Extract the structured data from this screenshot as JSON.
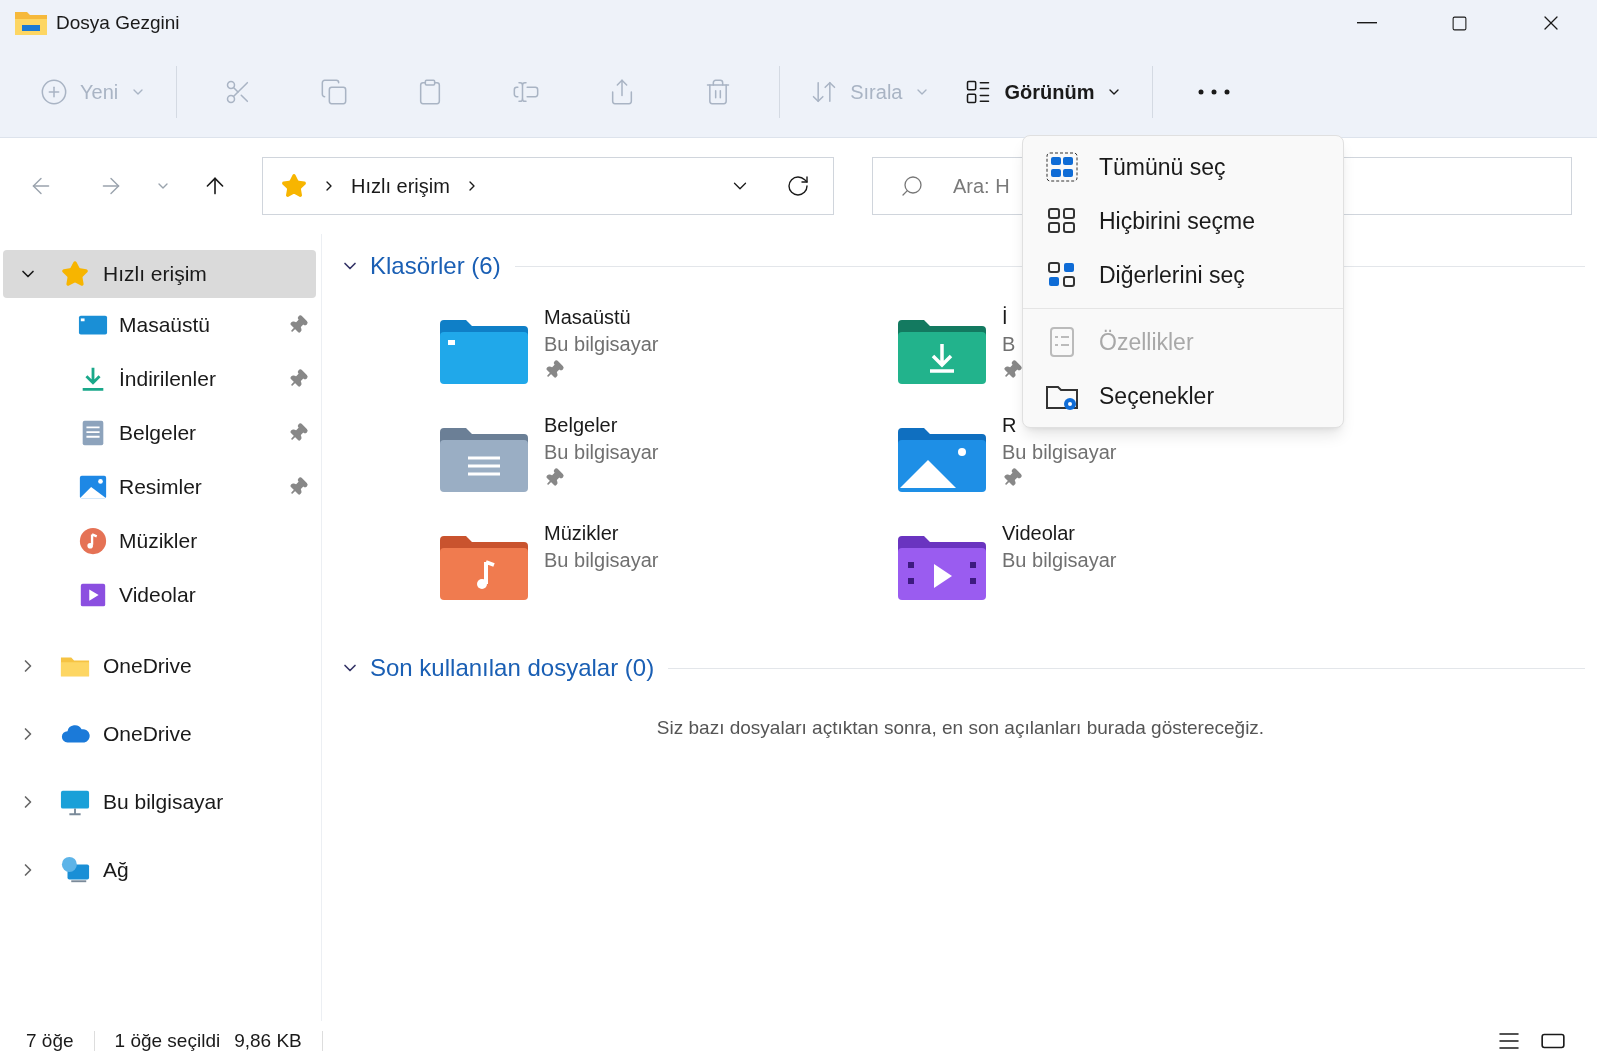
{
  "window": {
    "title": "Dosya Gezgini"
  },
  "toolbar": [
    {
      "kind": "new",
      "label": "Yeni",
      "disabled": true
    },
    {
      "kind": "separator"
    },
    {
      "kind": "cut",
      "disabled": true
    },
    {
      "kind": "copy",
      "disabled": true
    },
    {
      "kind": "paste",
      "disabled": true
    },
    {
      "kind": "rename",
      "disabled": true
    },
    {
      "kind": "share",
      "disabled": true
    },
    {
      "kind": "delete",
      "disabled": true
    },
    {
      "kind": "separator"
    },
    {
      "kind": "sort",
      "label": "Sırala",
      "disabled": true
    },
    {
      "kind": "view",
      "label": "Görünüm",
      "disabled": false
    },
    {
      "kind": "separator"
    },
    {
      "kind": "more",
      "disabled": false
    }
  ],
  "nav": {
    "back_disabled": true,
    "forward_disabled": true,
    "up_disabled": false
  },
  "address": {
    "path": [
      "Hızlı erişim"
    ]
  },
  "search": {
    "placeholder": "Ara: H"
  },
  "sidebar": {
    "items": [
      {
        "label": "Hızlı erişim",
        "kind": "star",
        "expanded": true,
        "selected": true,
        "children": [
          {
            "label": "Masaüstü",
            "kind": "desktop",
            "pinned": true,
            "selected": false
          },
          {
            "label": "İndirilenler",
            "kind": "download",
            "pinned": true,
            "selected": false
          },
          {
            "label": "Belgeler",
            "kind": "documents",
            "pinned": true,
            "selected": false
          },
          {
            "label": "Resimler",
            "kind": "pictures",
            "pinned": true,
            "selected": false
          },
          {
            "label": "Müzikler",
            "kind": "music",
            "pinned": false,
            "selected": false
          },
          {
            "label": "Videolar",
            "kind": "videos",
            "pinned": false,
            "selected": false
          }
        ]
      },
      {
        "label": "OneDrive",
        "kind": "folder",
        "expanded": false,
        "selected": false
      },
      {
        "label": "OneDrive",
        "kind": "cloud",
        "expanded": false,
        "selected": false
      },
      {
        "label": "Bu bilgisayar",
        "kind": "computer",
        "expanded": false,
        "selected": false
      },
      {
        "label": "Ağ",
        "kind": "network",
        "expanded": false,
        "selected": false
      }
    ]
  },
  "folders_section": {
    "title": "Klasörler (6)",
    "expanded": true,
    "items": [
      {
        "name": "Masaüstü",
        "location": "Bu bilgisayar",
        "kind": "desktop",
        "pinned": true
      },
      {
        "name": "İ",
        "location": "B",
        "kind": "download",
        "pinned": true
      },
      {
        "name": "Belgeler",
        "location": "Bu bilgisayar",
        "kind": "documents",
        "pinned": true
      },
      {
        "name": "R",
        "location": "Bu bilgisayar",
        "kind": "pictures",
        "pinned": true
      },
      {
        "name": "Müzikler",
        "location": "Bu bilgisayar",
        "kind": "music",
        "pinned": false
      },
      {
        "name": "Videolar",
        "location": "Bu bilgisayar",
        "kind": "videos",
        "pinned": false
      }
    ]
  },
  "recent_section": {
    "title": "Son kullanılan dosyalar (0)",
    "expanded": true,
    "message": "Siz bazı dosyaları açtıktan sonra, en son açılanları burada göstereceğiz."
  },
  "menu": {
    "sections": [
      [
        {
          "label": "Tümünü seç",
          "kind": "select-all",
          "disabled": false
        },
        {
          "label": "Hiçbirini seçme",
          "kind": "select-none",
          "disabled": false
        },
        {
          "label": "Diğerlerini seç",
          "kind": "invert",
          "disabled": false
        }
      ],
      [
        {
          "label": "Özellikler",
          "kind": "properties",
          "disabled": true
        },
        {
          "label": "Seçenekler",
          "kind": "options",
          "disabled": false
        }
      ]
    ]
  },
  "status_bar": {
    "count": "7 öğe",
    "selection": "1 öğe seçildi",
    "size": "9,86 KB"
  }
}
